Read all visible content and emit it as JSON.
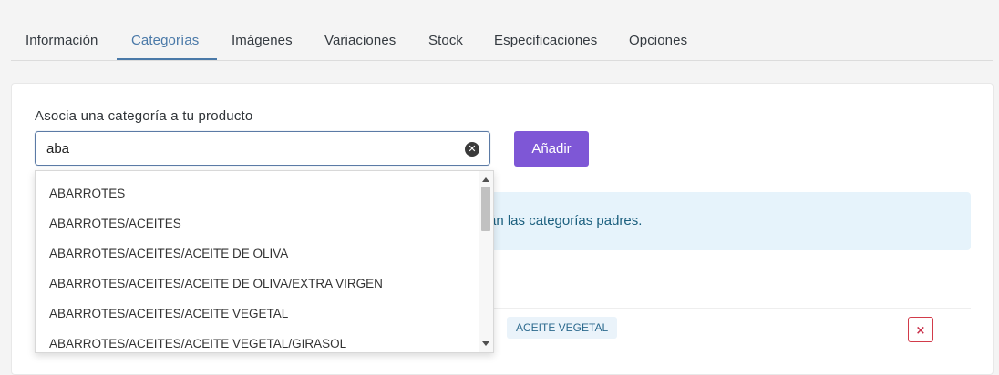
{
  "tabs": [
    "Información",
    "Categorías",
    "Imágenes",
    "Variaciones",
    "Stock",
    "Especificaciones",
    "Opciones"
  ],
  "active_tab": "Categorías",
  "form": {
    "label": "Asocia una categoría a tu producto",
    "search_value": "aba",
    "add_button": "Añadir"
  },
  "alert": {
    "visible_text": "án las categorías padres."
  },
  "dropdown": {
    "items": [
      "ABARROTES",
      "ABARROTES/ACEITES",
      "ABARROTES/ACEITES/ACEITE DE OLIVA",
      "ABARROTES/ACEITES/ACEITE DE OLIVA/EXTRA VIRGEN",
      "ABARROTES/ACEITES/ACEITE VEGETAL",
      "ABARROTES/ACEITES/ACEITE VEGETAL/GIRASOL"
    ]
  },
  "category_row": {
    "tags": [
      "ACEITE VEGETAL"
    ],
    "delete_symbol": "×"
  },
  "colors": {
    "accent_tab": "#4a79a8",
    "add_button": "#7e57d6",
    "alert_bg": "#e6f3fb",
    "alert_text": "#1b5f7e",
    "delete": "#d23b4a"
  }
}
